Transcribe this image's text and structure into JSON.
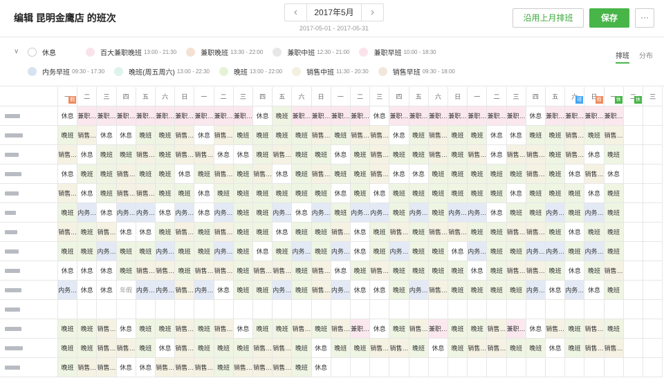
{
  "header": {
    "title": "编辑 昆明金鹰店 的班次",
    "month": "2017年5月",
    "date_range": "2017-05-01 - 2017-05-31",
    "prev_label": "沿用上月排班",
    "save_label": "保存",
    "more_label": "···"
  },
  "legend": {
    "row1": [
      {
        "name": "休息",
        "time": "",
        "color": "#ffffff"
      },
      {
        "name": "百大兼职晚班",
        "time": "13:00 - 21:30",
        "color": "#f9e3ea"
      },
      {
        "name": "兼职晚班",
        "time": "13:30 - 22:00",
        "color": "#f5e1d3"
      },
      {
        "name": "兼职中班",
        "time": "12:30 - 21:00",
        "color": "#e7e7e7"
      },
      {
        "name": "兼职早班",
        "time": "10:00 - 18:30",
        "color": "#fbe3ec"
      }
    ],
    "row2": [
      {
        "name": "内务早班",
        "time": "09:30 - 17:30",
        "color": "#d8e3f2"
      },
      {
        "name": "晚班(周五周六)",
        "time": "13:00 - 22:30",
        "color": "#ddf3ec"
      },
      {
        "name": "晚班",
        "time": "13:00 - 22:00",
        "color": "#e6f1d6"
      },
      {
        "name": "销售中班",
        "time": "11:30 - 20:30",
        "color": "#f3f0df"
      },
      {
        "name": "销售早班",
        "time": "09:30 - 18:00",
        "color": "#f2e7dc"
      }
    ]
  },
  "tabs": {
    "schedule": "排班",
    "distribution": "分布"
  },
  "weekdays": [
    "一",
    "二",
    "三",
    "四",
    "五",
    "六",
    "日",
    "一",
    "二",
    "三",
    "四",
    "五",
    "六",
    "日",
    "一",
    "二",
    "三",
    "四",
    "五",
    "六",
    "日",
    "一",
    "二",
    "三",
    "四",
    "五",
    "六",
    "日",
    "一",
    "二",
    "三"
  ],
  "badges": [
    {
      "col": 0,
      "text": "假",
      "color": "#f08a5d"
    },
    {
      "col": 26,
      "text": "班",
      "color": "#42a5f5"
    },
    {
      "col": 27,
      "text": "假",
      "color": "#f08a5d"
    },
    {
      "col": 28,
      "text": "休",
      "color": "#47b548"
    },
    {
      "col": 29,
      "text": "休",
      "color": "#47b548"
    }
  ],
  "rows": [
    [
      "休息",
      "兼职…",
      "兼职…",
      "兼职…",
      "兼职…",
      "兼职…",
      "兼职…",
      "兼职…",
      "兼职…",
      "兼职…",
      "休息",
      "晚班",
      "兼职…",
      "兼职…",
      "兼职…",
      "兼职…",
      "休息",
      "兼职…",
      "兼职…",
      "兼职…",
      "兼职…",
      "兼职…",
      "兼职…",
      "兼职…",
      "休息",
      "兼职…",
      "兼职…",
      "兼职…",
      "兼职…",
      "",
      ""
    ],
    [
      "晚班",
      "销售…",
      "休息",
      "休息",
      "晚班",
      "晚班",
      "销售…",
      "休息",
      "销售…",
      "晚班",
      "晚班",
      "晚班",
      "晚班",
      "销售…",
      "晚班",
      "销售…",
      "销售…",
      "休息",
      "晚班",
      "销售…",
      "晚班",
      "晚班",
      "休息",
      "休息",
      "晚班",
      "晚班",
      "销售…",
      "晚班",
      "销售…",
      "",
      ""
    ],
    [
      "销售…",
      "休息",
      "晚班",
      "晚班",
      "销售…",
      "晚班",
      "销售…",
      "销售…",
      "休息",
      "休息",
      "晚班",
      "销售…",
      "晚班",
      "晚班",
      "休息",
      "晚班",
      "销售…",
      "晚班",
      "晚班",
      "销售…",
      "晚班",
      "销售…",
      "休息",
      "销售…",
      "销售…",
      "晚班",
      "销售…",
      "休息",
      "晚班",
      "",
      ""
    ],
    [
      "休息",
      "晚班",
      "晚班",
      "销售…",
      "晚班",
      "晚班",
      "休息",
      "晚班",
      "销售…",
      "晚班",
      "销售…",
      "休息",
      "晚班",
      "销售…",
      "晚班",
      "晚班",
      "销售…",
      "休息",
      "休息",
      "晚班",
      "晚班",
      "晚班",
      "晚班",
      "晚班",
      "销售…",
      "晚班",
      "休息",
      "销售…",
      "休息",
      "",
      ""
    ],
    [
      "销售…",
      "休息",
      "晚班",
      "销售…",
      "销售…",
      "晚班",
      "晚班",
      "休息",
      "晚班",
      "晚班",
      "晚班",
      "晚班",
      "晚班",
      "晚班",
      "休息",
      "晚班",
      "休息",
      "晚班",
      "晚班",
      "晚班",
      "晚班",
      "晚班",
      "晚班",
      "休息",
      "晚班",
      "晚班",
      "晚班",
      "休息",
      "晚班",
      "",
      ""
    ],
    [
      "晚班",
      "内务…",
      "休息",
      "内务…",
      "内务…",
      "休息",
      "内务…",
      "休息",
      "内务…",
      "晚班",
      "晚班",
      "内务…",
      "休息",
      "内务…",
      "晚班",
      "内务…",
      "内务…",
      "晚班",
      "内务…",
      "晚班",
      "内务…",
      "内务…",
      "休息",
      "晚班",
      "晚班",
      "内务…",
      "晚班",
      "内务…",
      "晚班",
      "",
      ""
    ],
    [
      "销售…",
      "晚班",
      "销售…",
      "休息",
      "休息",
      "晚班",
      "销售…",
      "晚班",
      "销售…",
      "晚班",
      "晚班",
      "休息",
      "晚班",
      "晚班",
      "销售…",
      "休息",
      "晚班",
      "销售…",
      "晚班",
      "销售…",
      "销售…",
      "晚班",
      "晚班",
      "销售…",
      "销售…",
      "晚班",
      "休息",
      "晚班",
      "晚班",
      "",
      ""
    ],
    [
      "晚班",
      "晚班",
      "内务…",
      "晚班",
      "晚班",
      "内务…",
      "晚班",
      "晚班",
      "内务…",
      "晚班",
      "休息",
      "晚班",
      "内务…",
      "晚班",
      "内务…",
      "休息",
      "晚班",
      "内务…",
      "晚班",
      "晚班",
      "休息",
      "内务…",
      "晚班",
      "晚班",
      "内务…",
      "内务…",
      "晚班",
      "内务…",
      "晚班",
      "",
      ""
    ],
    [
      "休息",
      "休息",
      "休息",
      "晚班",
      "销售…",
      "销售…",
      "晚班",
      "销售…",
      "销售…",
      "晚班",
      "销售…",
      "销售…",
      "晚班",
      "销售…",
      "休息",
      "晚班",
      "销售…",
      "晚班",
      "晚班",
      "晚班",
      "晚班",
      "休息",
      "晚班",
      "销售…",
      "销售…",
      "晚班",
      "休息",
      "晚班",
      "销售…",
      "",
      ""
    ],
    [
      "内务…",
      "休息",
      "休息",
      "年假",
      "内务…",
      "内务…",
      "销售…",
      "内务…",
      "休息",
      "晚班",
      "晚班",
      "内务…",
      "晚班",
      "销售…",
      "内务…",
      "休息",
      "休息",
      "晚班",
      "内务…",
      "销售…",
      "晚班",
      "晚班",
      "晚班",
      "晚班",
      "内务…",
      "休息",
      "内务…",
      "休息",
      "晚班",
      "",
      ""
    ],
    [
      "",
      "",
      "",
      "",
      "",
      "",
      "",
      "",
      "",
      "",
      "",
      "",
      "",
      "",
      "",
      "",
      "",
      "",
      "",
      "",
      "",
      "",
      "",
      "",
      "",
      "",
      "",
      "",
      "",
      "",
      ""
    ],
    [
      "晚班",
      "晚班",
      "销售…",
      "休息",
      "晚班",
      "晚班",
      "销售…",
      "晚班",
      "销售…",
      "休息",
      "晚班",
      "晚班",
      "销售…",
      "晚班",
      "销售…",
      "兼职…",
      "休息",
      "晚班",
      "销售…",
      "兼职…",
      "晚班",
      "晚班",
      "销售…",
      "兼职…",
      "休息",
      "销售…",
      "晚班",
      "销售…",
      "晚班",
      "",
      ""
    ],
    [
      "晚班",
      "晚班",
      "销售…",
      "销售…",
      "晚班",
      "休息",
      "销售…",
      "晚班",
      "晚班",
      "晚班",
      "销售…",
      "销售…",
      "晚班",
      "休息",
      "晚班",
      "晚班",
      "销售…",
      "销售…",
      "晚班",
      "休息",
      "晚班",
      "销售…",
      "销售…",
      "晚班",
      "晚班",
      "休息",
      "晚班",
      "销售…",
      "销售…",
      "",
      ""
    ],
    [
      "晚班",
      "销售…",
      "销售…",
      "休息",
      "休息",
      "销售…",
      "销售…",
      "销售…",
      "晚班",
      "销售…",
      "销售…",
      "销售…",
      "晚班",
      "休息",
      "",
      "",
      "",
      "",
      "",
      "",
      "",
      "",
      "",
      "",
      "",
      "",
      "",
      "",
      "",
      "",
      ""
    ]
  ]
}
